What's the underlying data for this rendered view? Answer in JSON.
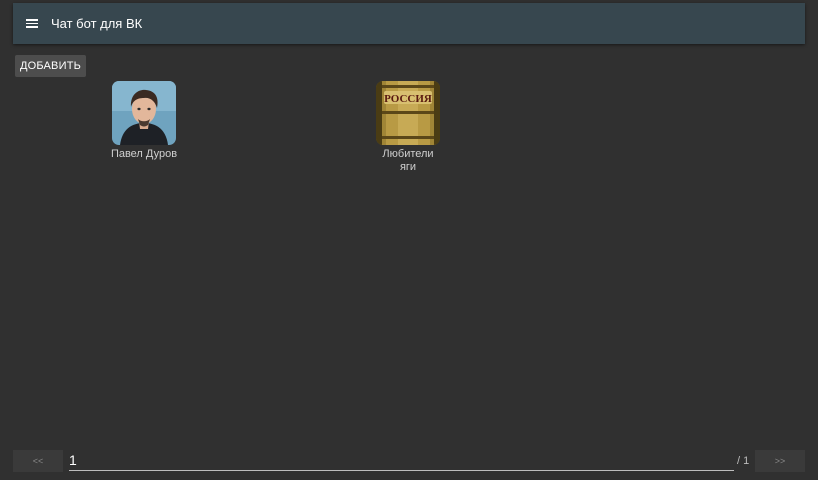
{
  "appbar": {
    "title": "Чат бот для ВК",
    "menu_icon": "hamburger-menu-icon"
  },
  "toolbar": {
    "add_label": "ДОБАВИТЬ"
  },
  "chats": [
    {
      "name": "Павел Дуров",
      "avatar": "person-portrait"
    },
    {
      "name": "Любители яги",
      "avatar": "russia-barrel"
    }
  ],
  "pagination": {
    "prev_label": "<<",
    "next_label": ">>",
    "current_page": "1",
    "total_label": "/ 1"
  },
  "colors": {
    "background": "#303030",
    "appbar": "#37474f",
    "button": "#4d4d4d"
  }
}
